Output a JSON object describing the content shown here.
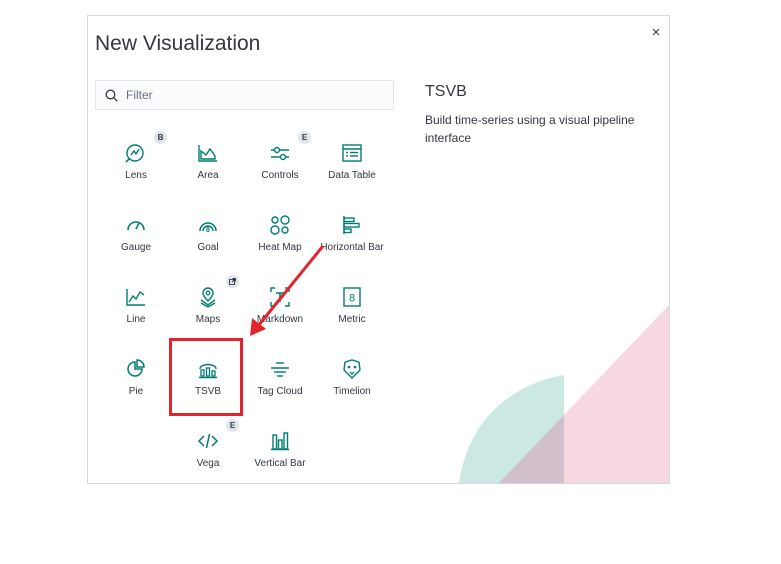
{
  "modal": {
    "title": "New Visualization",
    "close_glyph": "×",
    "search_placeholder": "Filter"
  },
  "tiles": [
    {
      "label": "Lens",
      "icon": "lens-icon",
      "badge": "B"
    },
    {
      "label": "Area",
      "icon": "area-chart-icon"
    },
    {
      "label": "Controls",
      "icon": "controls-icon",
      "badge": "E"
    },
    {
      "label": "Data Table",
      "icon": "data-table-icon"
    },
    {
      "label": "Gauge",
      "icon": "gauge-icon"
    },
    {
      "label": "Goal",
      "icon": "goal-icon"
    },
    {
      "label": "Heat Map",
      "icon": "heat-map-icon"
    },
    {
      "label": "Horizontal Bar",
      "icon": "horizontal-bar-icon"
    },
    {
      "label": "Line",
      "icon": "line-chart-icon"
    },
    {
      "label": "Maps",
      "icon": "maps-icon",
      "badge_icon": "external-link-icon"
    },
    {
      "label": "Markdown",
      "icon": "markdown-icon"
    },
    {
      "label": "Metric",
      "icon": "metric-icon"
    },
    {
      "label": "Pie",
      "icon": "pie-chart-icon"
    },
    {
      "label": "TSVB",
      "icon": "tsvb-icon"
    },
    {
      "label": "Tag Cloud",
      "icon": "tag-cloud-icon"
    },
    {
      "label": "Timelion",
      "icon": "timelion-icon"
    },
    {
      "label": "Vega",
      "icon": "vega-code-icon",
      "badge": "E"
    },
    {
      "label": "Vertical Bar",
      "icon": "vertical-bar-icon"
    }
  ],
  "detail": {
    "title": "TSVB",
    "description": "Build time-series using a visual pipeline interface"
  },
  "colors": {
    "icon": "#017d73",
    "highlight": "#e3242b",
    "decor_pink": "#f0b8c8",
    "decor_teal": "#b9e0d9"
  }
}
